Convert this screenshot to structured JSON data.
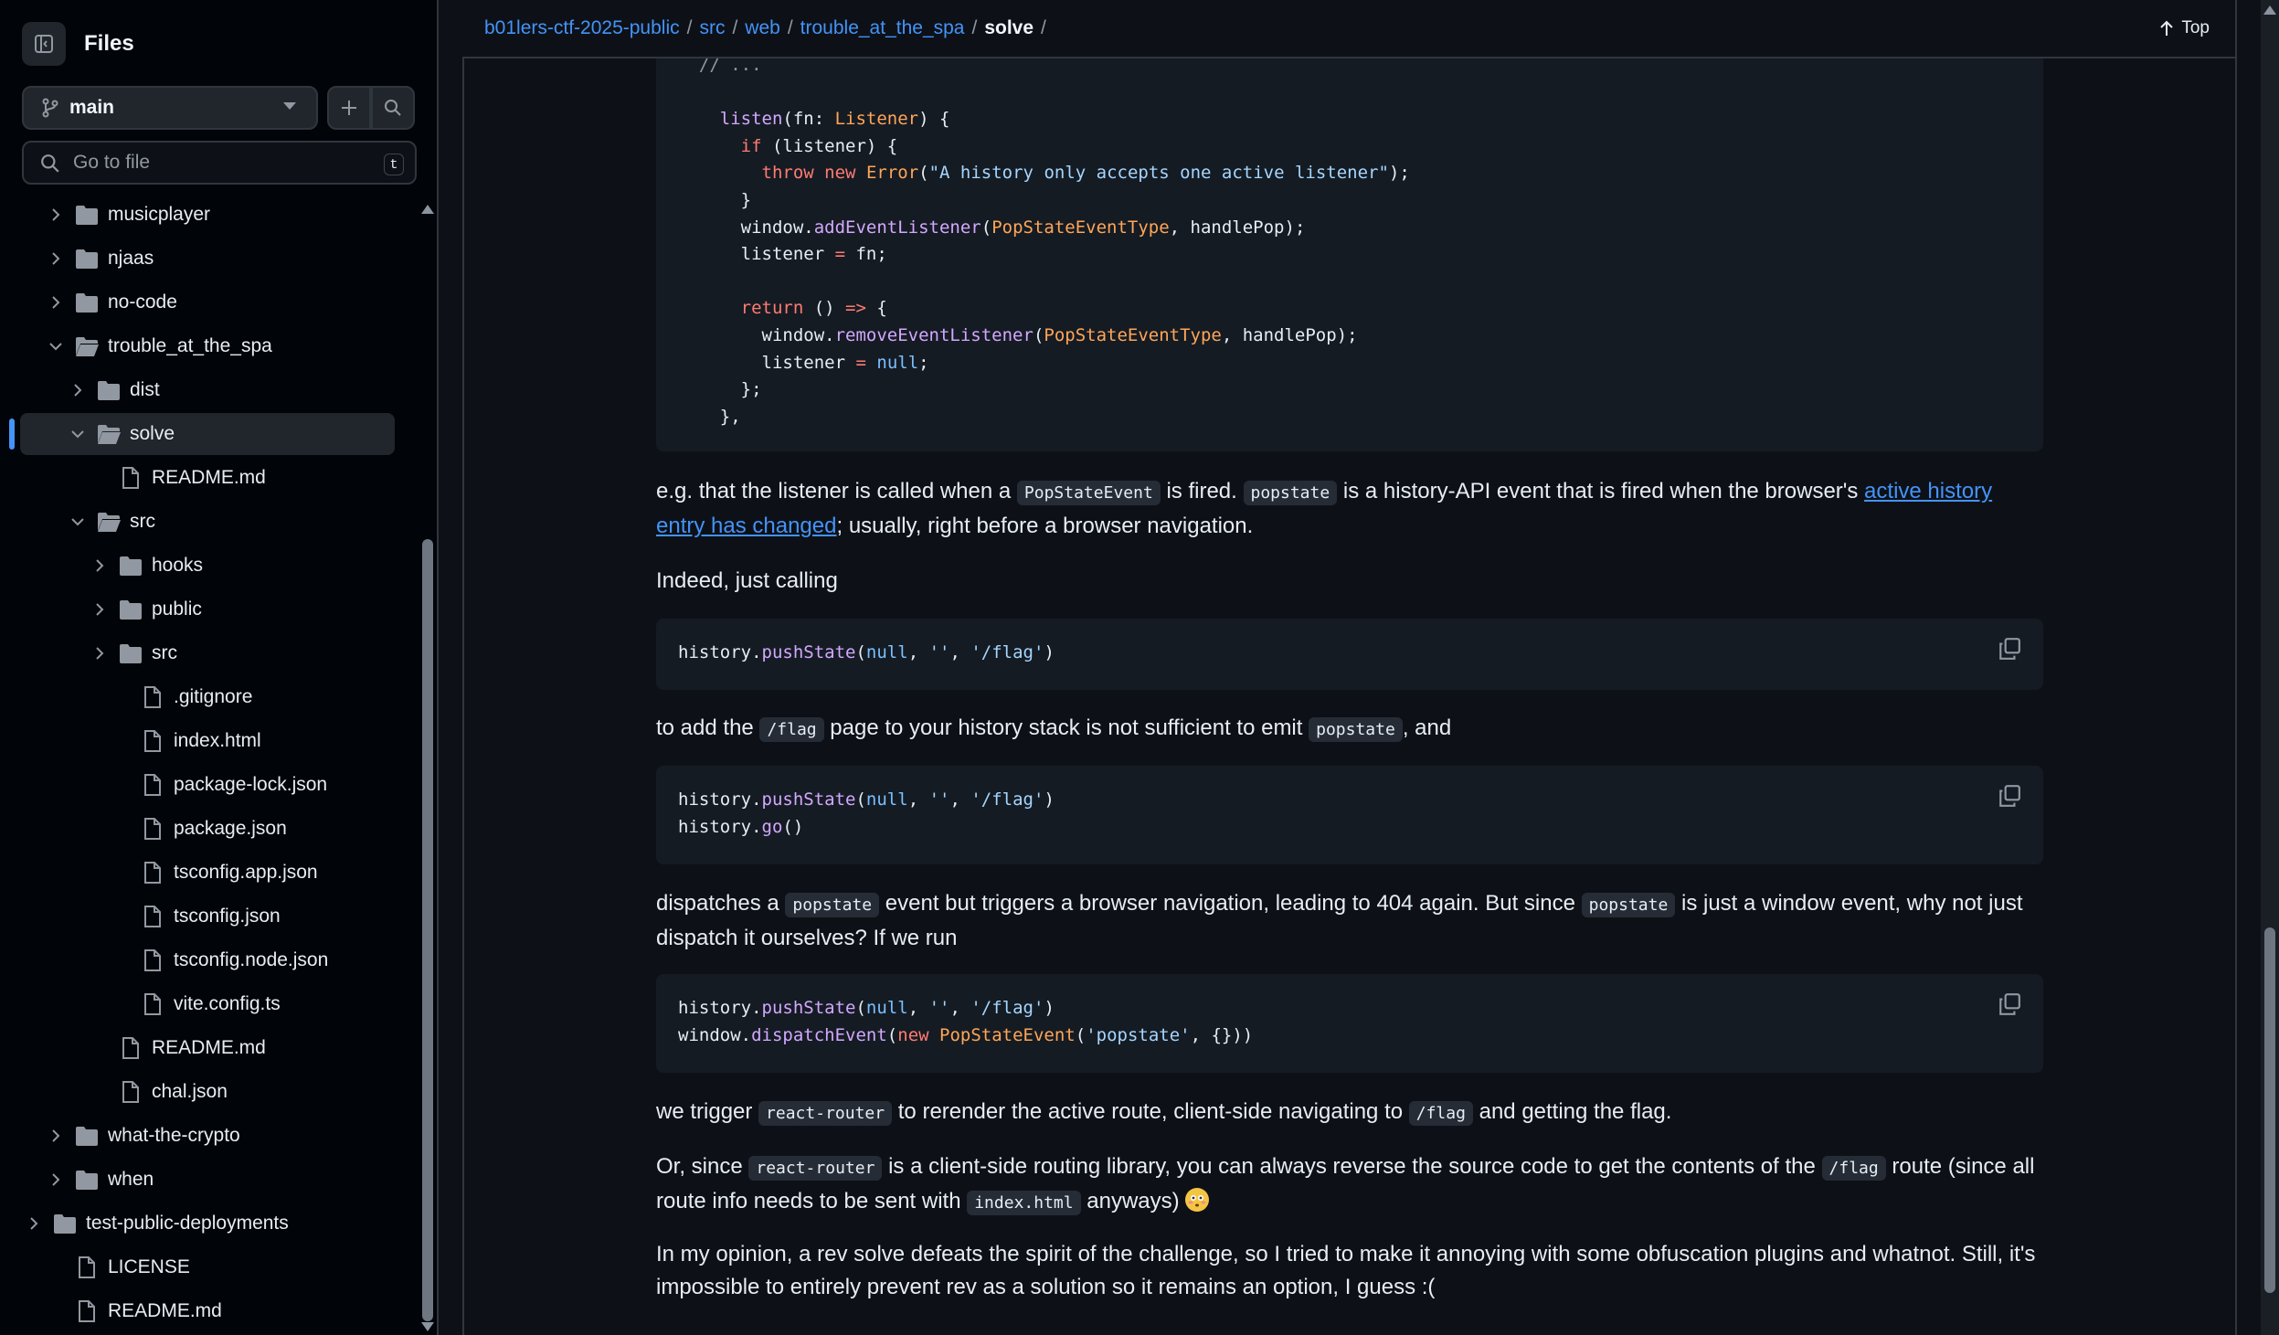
{
  "sidebar": {
    "title": "Files",
    "branch": "main",
    "goto_placeholder": "Go to file",
    "goto_shortcut": "t",
    "tree": [
      {
        "label": "musicplayer",
        "type": "folder",
        "depth": 1,
        "expanded": false
      },
      {
        "label": "njaas",
        "type": "folder",
        "depth": 1,
        "expanded": false
      },
      {
        "label": "no-code",
        "type": "folder",
        "depth": 1,
        "expanded": false
      },
      {
        "label": "trouble_at_the_spa",
        "type": "folder",
        "depth": 1,
        "expanded": true
      },
      {
        "label": "dist",
        "type": "folder",
        "depth": 2,
        "expanded": false
      },
      {
        "label": "solve",
        "type": "folder",
        "depth": 2,
        "expanded": true,
        "selected": true
      },
      {
        "label": "README.md",
        "type": "file",
        "depth": 3
      },
      {
        "label": "src",
        "type": "folder",
        "depth": 2,
        "expanded": true
      },
      {
        "label": "hooks",
        "type": "folder",
        "depth": 3,
        "expanded": false
      },
      {
        "label": "public",
        "type": "folder",
        "depth": 3,
        "expanded": false
      },
      {
        "label": "src",
        "type": "folder",
        "depth": 3,
        "expanded": false
      },
      {
        "label": ".gitignore",
        "type": "file",
        "depth": 4
      },
      {
        "label": "index.html",
        "type": "file",
        "depth": 4
      },
      {
        "label": "package-lock.json",
        "type": "file",
        "depth": 4
      },
      {
        "label": "package.json",
        "type": "file",
        "depth": 4
      },
      {
        "label": "tsconfig.app.json",
        "type": "file",
        "depth": 4
      },
      {
        "label": "tsconfig.json",
        "type": "file",
        "depth": 4
      },
      {
        "label": "tsconfig.node.json",
        "type": "file",
        "depth": 4
      },
      {
        "label": "vite.config.ts",
        "type": "file",
        "depth": 4
      },
      {
        "label": "README.md",
        "type": "file",
        "depth": 3
      },
      {
        "label": "chal.json",
        "type": "file",
        "depth": 3
      },
      {
        "label": "what-the-crypto",
        "type": "folder",
        "depth": 1,
        "expanded": false
      },
      {
        "label": "when",
        "type": "folder",
        "depth": 1,
        "expanded": false
      },
      {
        "label": "test-public-deployments",
        "type": "folder",
        "depth": 0,
        "expanded": false
      },
      {
        "label": "LICENSE",
        "type": "file",
        "depth": 1
      },
      {
        "label": "README.md",
        "type": "file",
        "depth": 1
      }
    ]
  },
  "breadcrumb": {
    "repo": "b01lers-ctf-2025-public",
    "parts": [
      "src",
      "web",
      "trouble_at_the_spa"
    ],
    "current": "solve",
    "top_label": "Top"
  },
  "content": {
    "code1": [
      [
        [
          "c",
          "// ..."
        ]
      ],
      [],
      [
        [
          "f",
          "listen"
        ],
        [
          "p",
          "(fn: "
        ],
        [
          "t",
          "Listener"
        ],
        [
          "p",
          ") {"
        ]
      ],
      [
        [
          "k",
          "if"
        ],
        [
          "p",
          " (listener) {"
        ]
      ],
      [
        [
          "k",
          "throw"
        ],
        [
          "p",
          " "
        ],
        [
          "k",
          "new"
        ],
        [
          "p",
          " "
        ],
        [
          "t",
          "Error"
        ],
        [
          "p",
          "("
        ],
        [
          "s",
          "\"A history only accepts one active listener\""
        ],
        [
          "p",
          ");"
        ]
      ],
      [
        [
          "p",
          "}"
        ]
      ],
      [
        [
          "p",
          "window."
        ],
        [
          "f",
          "addEventListener"
        ],
        [
          "p",
          "("
        ],
        [
          "t",
          "PopStateEventType"
        ],
        [
          "p",
          ", handlePop);"
        ]
      ],
      [
        [
          "p",
          "listener "
        ],
        [
          "k",
          "="
        ],
        [
          "p",
          " fn;"
        ]
      ],
      [],
      [
        [
          "k",
          "return"
        ],
        [
          "p",
          " () "
        ],
        [
          "k",
          "=>"
        ],
        [
          "p",
          " {"
        ]
      ],
      [
        [
          "p",
          "window."
        ],
        [
          "f",
          "removeEventListener"
        ],
        [
          "p",
          "("
        ],
        [
          "t",
          "PopStateEventType"
        ],
        [
          "p",
          ", handlePop);"
        ]
      ],
      [
        [
          "p",
          "listener "
        ],
        [
          "k",
          "="
        ],
        [
          "p",
          " "
        ],
        [
          "n",
          "null"
        ],
        [
          "p",
          ";"
        ]
      ],
      [
        [
          "p",
          "};"
        ]
      ],
      [
        [
          "p",
          "},"
        ]
      ]
    ],
    "code1_indents": [
      1,
      0,
      2,
      3,
      4,
      3,
      3,
      3,
      0,
      3,
      4,
      4,
      3,
      2
    ],
    "para1": [
      {
        "t": "text",
        "v": "e.g. that the listener is called when a "
      },
      {
        "t": "code",
        "v": "PopStateEvent"
      },
      {
        "t": "text",
        "v": " is fired. "
      },
      {
        "t": "code",
        "v": "popstate"
      },
      {
        "t": "text",
        "v": " is a history-API event that is fired when the browser's "
      },
      {
        "t": "link",
        "v": "active history entry has changed"
      },
      {
        "t": "text",
        "v": "; usually, right before a browser navigation."
      }
    ],
    "para2": [
      {
        "t": "text",
        "v": "Indeed, just calling"
      }
    ],
    "code2": [
      [
        [
          "p",
          "history."
        ],
        [
          "f",
          "pushState"
        ],
        [
          "p",
          "("
        ],
        [
          "n",
          "null"
        ],
        [
          "p",
          ", "
        ],
        [
          "s",
          "''"
        ],
        [
          "p",
          ", "
        ],
        [
          "s",
          "'/flag'"
        ],
        [
          "p",
          ")"
        ]
      ]
    ],
    "para3": [
      {
        "t": "text",
        "v": "to add the "
      },
      {
        "t": "code",
        "v": "/flag"
      },
      {
        "t": "text",
        "v": " page to your history stack is not sufficient to emit "
      },
      {
        "t": "code",
        "v": "popstate"
      },
      {
        "t": "text",
        "v": ", and"
      }
    ],
    "code3": [
      [
        [
          "p",
          "history."
        ],
        [
          "f",
          "pushState"
        ],
        [
          "p",
          "("
        ],
        [
          "n",
          "null"
        ],
        [
          "p",
          ", "
        ],
        [
          "s",
          "''"
        ],
        [
          "p",
          ", "
        ],
        [
          "s",
          "'/flag'"
        ],
        [
          "p",
          ")"
        ]
      ],
      [
        [
          "p",
          "history."
        ],
        [
          "f",
          "go"
        ],
        [
          "p",
          "()"
        ]
      ]
    ],
    "para4": [
      {
        "t": "text",
        "v": "dispatches a "
      },
      {
        "t": "code",
        "v": "popstate"
      },
      {
        "t": "text",
        "v": " event but triggers a browser navigation, leading to 404 again. But since "
      },
      {
        "t": "code",
        "v": "popstate"
      },
      {
        "t": "text",
        "v": " is just a window event, why not just dispatch it ourselves? If we run"
      }
    ],
    "code4": [
      [
        [
          "p",
          "history."
        ],
        [
          "f",
          "pushState"
        ],
        [
          "p",
          "("
        ],
        [
          "n",
          "null"
        ],
        [
          "p",
          ", "
        ],
        [
          "s",
          "''"
        ],
        [
          "p",
          ", "
        ],
        [
          "s",
          "'/flag'"
        ],
        [
          "p",
          ")"
        ]
      ],
      [
        [
          "p",
          "window."
        ],
        [
          "f",
          "dispatchEvent"
        ],
        [
          "p",
          "("
        ],
        [
          "k",
          "new"
        ],
        [
          "p",
          " "
        ],
        [
          "t",
          "PopStateEvent"
        ],
        [
          "p",
          "("
        ],
        [
          "s",
          "'popstate'"
        ],
        [
          "p",
          ", {}))"
        ]
      ]
    ],
    "para5": [
      {
        "t": "text",
        "v": "we trigger "
      },
      {
        "t": "code",
        "v": "react-router"
      },
      {
        "t": "text",
        "v": " to rerender the active route, client-side navigating to "
      },
      {
        "t": "code",
        "v": "/flag"
      },
      {
        "t": "text",
        "v": " and getting the flag."
      }
    ],
    "para6": [
      {
        "t": "text",
        "v": "Or, since "
      },
      {
        "t": "code",
        "v": "react-router"
      },
      {
        "t": "text",
        "v": " is a client-side routing library, you can always reverse the source code to get the contents of the "
      },
      {
        "t": "code",
        "v": "/flag"
      },
      {
        "t": "text",
        "v": " route (since all route info needs to be sent with "
      },
      {
        "t": "code",
        "v": "index.html"
      },
      {
        "t": "text",
        "v": " anyways) "
      },
      {
        "t": "emoji",
        "v": "flushed-face"
      }
    ],
    "para7": [
      {
        "t": "text",
        "v": "In my opinion, a rev solve defeats the spirit of the challenge, so I tried to make it annoying with some obfuscation plugins and whatnot. Still, it's impossible to entirely prevent rev as a solution so it remains an option, I guess :("
      }
    ]
  },
  "colors": {
    "bg": "#0d1117",
    "sidebar_bg": "#010409",
    "accent": "#4493f8",
    "code_bg": "#151b23"
  }
}
